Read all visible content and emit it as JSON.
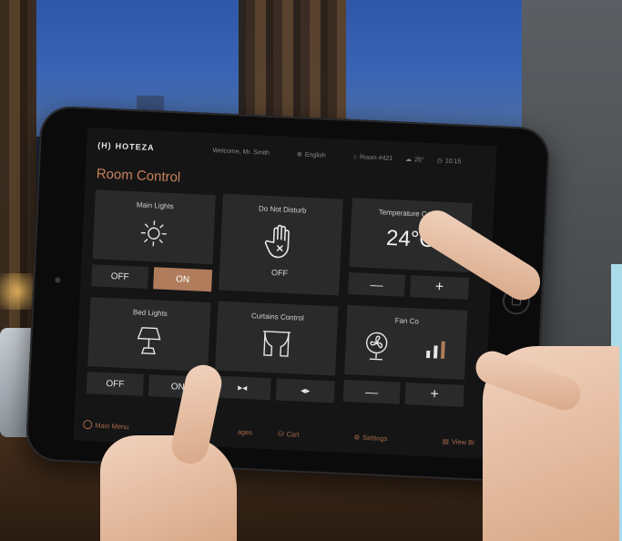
{
  "topbar": {
    "brand": "HOTEZA",
    "welcome": "Welcome, Mr. Smith",
    "language": "English",
    "room": "Room #421",
    "weather": "25°",
    "time": "10:15"
  },
  "page_title": "Room Control",
  "cards": {
    "main_lights": {
      "label": "Main Lights",
      "off": "OFF",
      "on": "ON",
      "state": "ON"
    },
    "dnd": {
      "label": "Do Not Disturb",
      "state": "OFF"
    },
    "temperature": {
      "label": "Temperature Control",
      "value": "24°C",
      "minus": "—",
      "plus": "+"
    },
    "bed_lights": {
      "label": "Bed Lights",
      "off": "OFF",
      "on": "ON"
    },
    "curtains": {
      "label": "Curtains Control",
      "close": "▸◂",
      "open": "◂▸"
    },
    "fan": {
      "label": "Fan Co",
      "minus": "—",
      "plus": "+"
    }
  },
  "bottombar": {
    "main_menu": "Main Menu",
    "messages": "ages",
    "cart": "Cart",
    "settings": "Settings",
    "view_bill": "View Bi"
  },
  "colors": {
    "accent": "#b07c5c",
    "card": "#2a2a2b",
    "screen": "#151516",
    "title": "#c9825a"
  }
}
